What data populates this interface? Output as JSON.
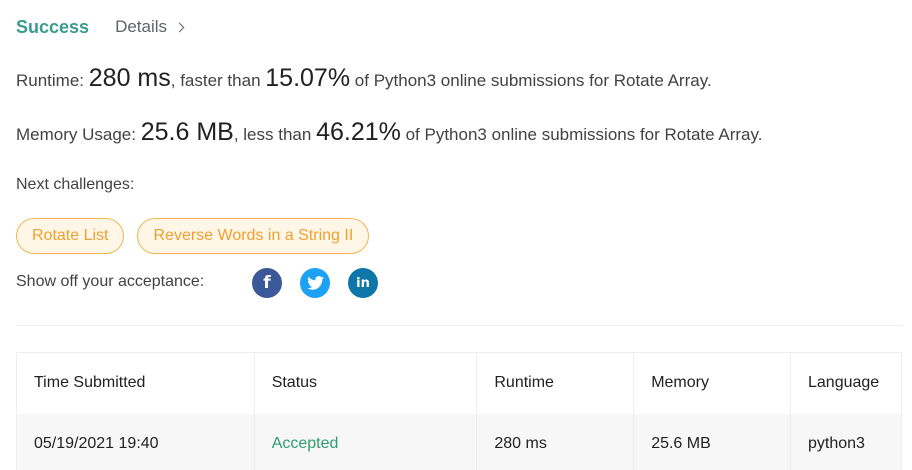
{
  "tabs": {
    "success": "Success",
    "details": "Details"
  },
  "runtime": {
    "label": "Runtime:",
    "value": "280 ms",
    "mid": ", faster than",
    "percent": "15.07%",
    "suffix": "of Python3 online submissions for Rotate Array."
  },
  "memory": {
    "label": "Memory Usage:",
    "value": "25.6 MB",
    "mid": ", less than",
    "percent": "46.21%",
    "suffix": "of Python3 online submissions for Rotate Array."
  },
  "next_challenges": {
    "label": "Next challenges:",
    "items": [
      "Rotate List",
      "Reverse Words in a String II"
    ]
  },
  "share": {
    "label": "Show off your acceptance:",
    "icons": [
      "facebook-icon",
      "twitter-icon",
      "linkedin-icon"
    ]
  },
  "table": {
    "headers": [
      "Time Submitted",
      "Status",
      "Runtime",
      "Memory",
      "Language"
    ],
    "rows": [
      [
        "05/19/2021 19:40",
        "Accepted",
        "280 ms",
        "25.6 MB",
        "python3"
      ]
    ]
  },
  "colors": {
    "accent": "#3a9b8e",
    "accepted": "#2e9b73",
    "chip_text": "#f0a030",
    "chip_border": "#f0b656",
    "chip_bg": "#fef6e6",
    "facebook": "#3b5998",
    "twitter": "#1da1f2",
    "linkedin": "#0e76a8"
  }
}
